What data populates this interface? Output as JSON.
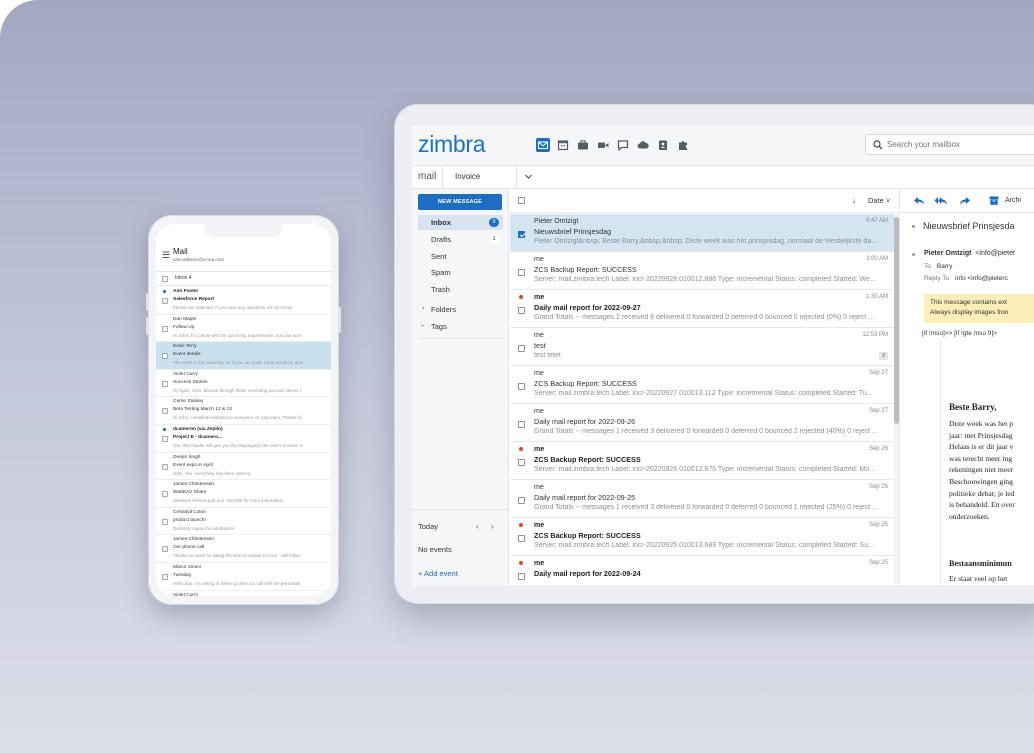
{
  "phone": {
    "header": {
      "title": "Mail",
      "account": "john.williams@xcorp.com"
    },
    "folder": "Inbox 4",
    "messages": [
      {
        "from": "Ann Foster",
        "subject": "Salesforce Report",
        "preview": "Please see attached. If you have any questions, let me know!",
        "unread": true,
        "selected": false
      },
      {
        "from": "Dan Maple",
        "subject": "Follow Up",
        "preview": "Hi John! To comply with the upcoming requirements, you can acce",
        "unread": false,
        "selected": false
      },
      {
        "from": "Essie Terry",
        "subject": "Event details",
        "preview": "The event is this Saturday, so if you can make it that would be grea",
        "unread": false,
        "selected": true
      },
      {
        "from": "Violet Curry",
        "subject": "Success Stories",
        "preview": "Hi Again, John. Browse through these mentoring success stories t",
        "unread": false,
        "selected": false
      },
      {
        "from": "Carrie Stanley",
        "subject": "Beta Testing March 12 & 13",
        "preview": "Hi John, I emailed invitations to everyone on your team. Thanks fo",
        "unread": false,
        "selected": false
      },
      {
        "from": "dcameron (via Zeplin)",
        "subject": "Project E - dcamero...",
        "preview": "Yes, that header will give you the language(s) the user's browser is",
        "unread": true,
        "selected": false
      },
      {
        "from": "Deepti Singh",
        "subject": "Event expo in April",
        "preview": "John, Yes, everything has been ordered.",
        "unread": false,
        "selected": false
      },
      {
        "from": "James Christensen",
        "subject": "WebDAV Share",
        "preview": "Solutions Review part one. Visit link for more information.",
        "unread": false,
        "selected": false
      },
      {
        "from": "Cristobal Colon",
        "subject": "product launch!",
        "preview": "Definitely cause for celebration!",
        "unread": false,
        "selected": false
      },
      {
        "from": "James Christensen",
        "subject": "Our phone call",
        "preview": "Thanks so much for taking the time to explain it to me. I will follow",
        "unread": false,
        "selected": false
      },
      {
        "from": "Marco Sirioni",
        "subject": "Tuesday",
        "preview": "Hello Jojo, I'm writing to follow up after our call with the presentati",
        "unread": false,
        "selected": false
      },
      {
        "from": "Violet Curry",
        "subject": "",
        "preview": "",
        "unread": false,
        "selected": false
      }
    ]
  },
  "tablet": {
    "logo": "zimbra",
    "apps": [
      "mail-icon",
      "calendar-icon",
      "briefcase-icon",
      "video-icon",
      "chat-icon",
      "cloud-icon",
      "contacts-icon",
      "puzzle-icon"
    ],
    "search": {
      "placeholder": "Search your mailbox"
    },
    "tabs": {
      "mail": "mail",
      "invoice": "Invoice"
    },
    "sidebar": {
      "new_message": "NEW MESSAGE",
      "folders": [
        {
          "label": "Inbox",
          "count": "9",
          "active": true
        },
        {
          "label": "Drafts",
          "count": "1",
          "active": false
        },
        {
          "label": "Sent",
          "count": "",
          "active": false
        },
        {
          "label": "Spam",
          "count": "",
          "active": false
        },
        {
          "label": "Trash",
          "count": "",
          "active": false
        }
      ],
      "folders_group": "Folders",
      "tags_group": "Tags",
      "calendar": {
        "today": "Today",
        "no_events": "No events",
        "add_event": "+  Add event"
      }
    },
    "list": {
      "sort_label": "Date",
      "messages": [
        {
          "from": "Pieter Omtzigt",
          "date": "8:47 AM",
          "subject": "Nieuwsbrief Prinsjesdag",
          "preview": "Pieter Omtzigt&nbsp; Beste Barry,&nbsp;&nbsp; Deze week was het prinsjesdag, normaal de feestelijkste da...",
          "unread": false,
          "selected": true,
          "count": ""
        },
        {
          "from": "me",
          "date": "3:00 AM",
          "subject": "ZCS Backup Report: SUCCESS",
          "preview": "Server: mail.zimbra.tech Label: incr-20220928.010012.886 Type: incremental Status: completed Started: We...",
          "unread": false,
          "selected": false,
          "count": ""
        },
        {
          "from": "me",
          "date": "1:30 AM",
          "subject": "Daily mail report for 2022-09-27",
          "preview": "Grand Totals -- messages 2 received 6 delivered 0 forwarded 0 deferred 0 bounced 0 rejected (0%) 0 reject ...",
          "unread": true,
          "selected": false,
          "count": ""
        },
        {
          "from": "me",
          "date": "12:53 PM",
          "subject": "test",
          "preview": "test tetet",
          "unread": false,
          "selected": false,
          "count": "2"
        },
        {
          "from": "me",
          "date": "Sep 27",
          "subject": "ZCS Backup Report: SUCCESS",
          "preview": "Server: mail.zimbra.tech Label: incr-20220927.010013.112 Type: incremental Status: completed Started: Tu...",
          "unread": false,
          "selected": false,
          "count": ""
        },
        {
          "from": "me",
          "date": "Sep 27",
          "subject": "Daily mail report for 2022-09-26",
          "preview": "Grand Totals -- messages 1 received 3 delivered 0 forwarded 0 deferred 0 bounced 2 rejected (40%) 0 reject ...",
          "unread": false,
          "selected": false,
          "count": ""
        },
        {
          "from": "me",
          "date": "Sep 26",
          "subject": "ZCS Backup Report: SUCCESS",
          "preview": "Server: mail.zimbra.tech Label: incr-20220926.010012.676 Type: incremental Status: completed Started: Mo...",
          "unread": true,
          "selected": false,
          "count": ""
        },
        {
          "from": "me",
          "date": "Sep 26",
          "subject": "Daily mail report for 2022-09-25",
          "preview": "Grand Totals -- messages 1 received 3 delivered 0 forwarded 0 deferred 0 bounced 1 rejected (25%) 0 reject ...",
          "unread": false,
          "selected": false,
          "count": ""
        },
        {
          "from": "me",
          "date": "Sep 25",
          "subject": "ZCS Backup Report: SUCCESS",
          "preview": "Server: mail.zimbra.tech Label: incr-20220925.010013.689 Type: incremental Status: completed Started: Su...",
          "unread": true,
          "selected": false,
          "count": ""
        },
        {
          "from": "me",
          "date": "Sep 25",
          "subject": "Daily mail report for 2022-09-24",
          "preview": "",
          "unread": true,
          "selected": false,
          "count": ""
        }
      ]
    },
    "reader": {
      "toolbar": {
        "archive": "Archi"
      },
      "title": "Nieuwsbrief Prinsjesda",
      "sender_name": "Pieter Omtzigt",
      "sender_email": "<info@pieter",
      "to_label": "To",
      "to_value": "Barry",
      "reply_label": "Reply To",
      "reply_value": "info  <info@pieterc",
      "banner_line1": "This message contains ext",
      "banner_line2": "Always display images fron",
      "raw_line": "[if !mso]>> [if !gte mso 9]>",
      "greeting": "Beste Barry,",
      "paragraph": [
        "Deze week was het p",
        "jaar: met Prinsjesdag",
        "Helaas is er dit jaar v",
        "was terecht meer ing",
        "rekeningen niet meer",
        "Beschouwingen ging",
        "politieke debat; je led",
        "is behandeld. En over",
        "onderzoeken."
      ],
      "heading2": "Bestaansminimun",
      "paragraph2": "Er staat veel op het"
    }
  },
  "colors": {
    "accent": "#1b6ec2",
    "unread_dot": "#e0452a",
    "selected_row": "#d3e5f1",
    "banner": "#fbeeb9",
    "background_top": "#a2a8c1"
  }
}
